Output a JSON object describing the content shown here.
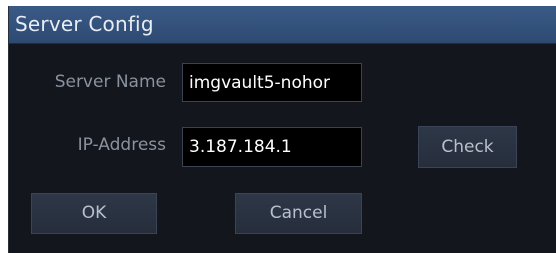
{
  "window": {
    "title": "Server Config"
  },
  "form": {
    "server_name": {
      "label": "Server Name",
      "value": "imgvault5-nohor"
    },
    "ip_address": {
      "label": "IP-Address",
      "value": "3.187.184.1"
    }
  },
  "buttons": {
    "check": "Check",
    "ok": "OK",
    "cancel": "Cancel"
  },
  "colors": {
    "titlebar": "#335180",
    "dialog_background": "#13161d",
    "field_background": "#000000",
    "button_background": "#2a3342",
    "label_text": "#8a929e"
  }
}
